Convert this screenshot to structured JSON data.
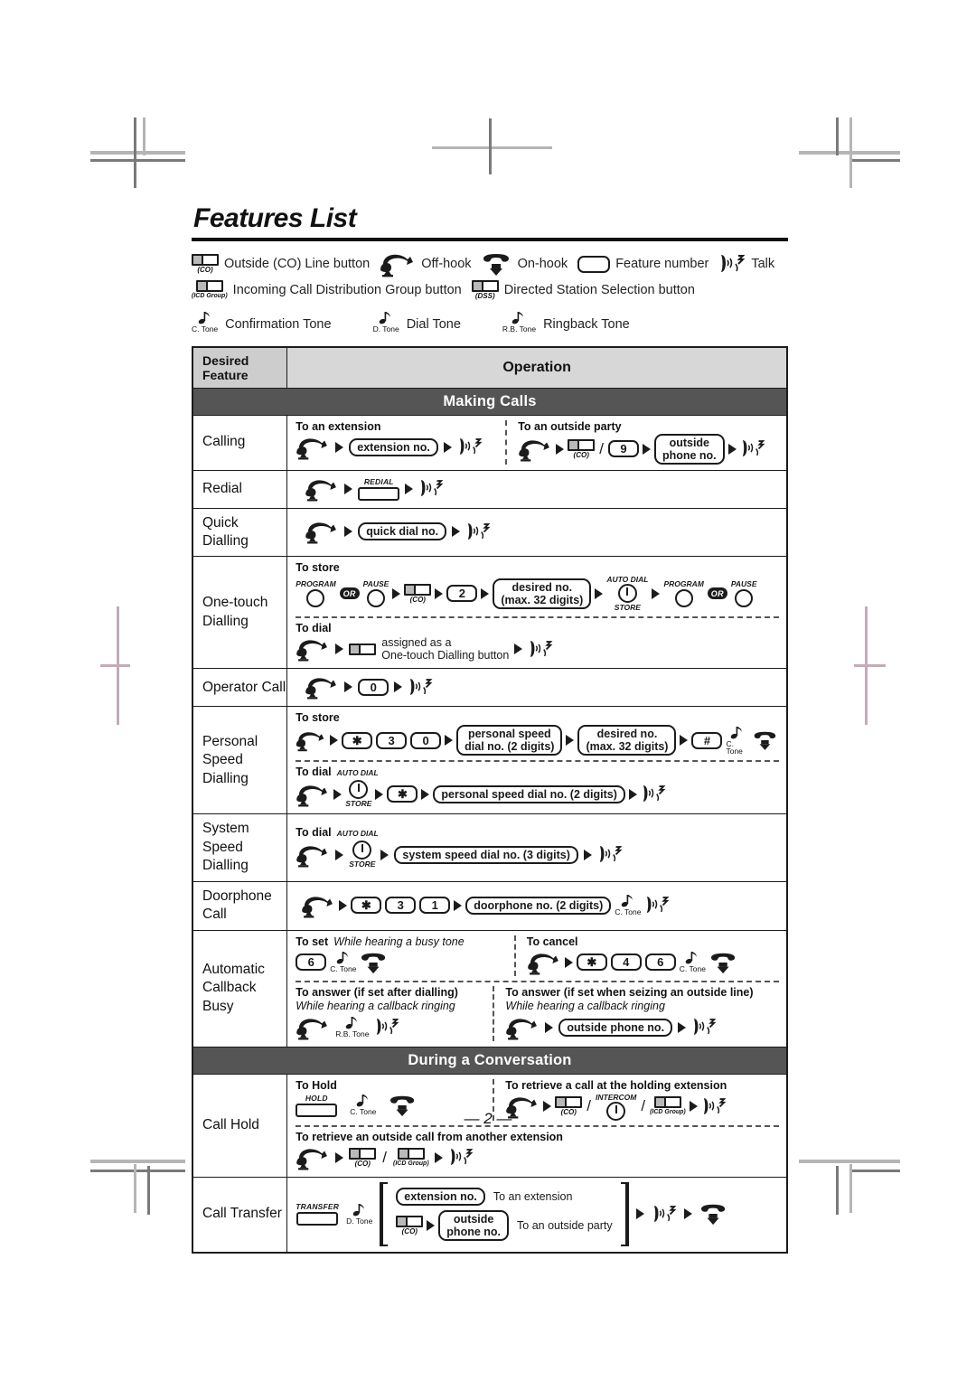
{
  "document": {
    "title": "Features List",
    "page_number": "— 2 —"
  },
  "legend": {
    "row1": [
      {
        "icon": "co-line-button-icon",
        "cap": "(CO)",
        "label": "Outside (CO) Line button"
      },
      {
        "icon": "off-hook-icon",
        "label": "Off-hook"
      },
      {
        "icon": "on-hook-icon",
        "label": "On-hook"
      },
      {
        "icon": "feature-number-key-icon",
        "label": "Feature number"
      },
      {
        "icon": "talk-icon",
        "label": "Talk"
      }
    ],
    "row2": [
      {
        "icon": "icd-group-button-icon",
        "cap": "(ICD Group)",
        "label": "Incoming Call Distribution Group button"
      },
      {
        "icon": "dss-button-icon",
        "cap": "(DSS)",
        "label": "Directed Station Selection button"
      }
    ],
    "tones": [
      {
        "icon": "tone-note-icon",
        "cap": "C. Tone",
        "label": "Confirmation Tone"
      },
      {
        "icon": "tone-note-icon",
        "cap": "D. Tone",
        "label": "Dial Tone"
      },
      {
        "icon": "tone-note-icon",
        "cap": "R.B. Tone",
        "label": "Ringback Tone"
      }
    ]
  },
  "table": {
    "headers": {
      "feature": "Desired Feature",
      "operation": "Operation"
    },
    "sections": [
      {
        "title": "Making Calls"
      },
      {
        "title": "During a Conversation"
      }
    ],
    "rows": {
      "calling": {
        "feature": "Calling",
        "left_label": "To an extension",
        "left_pill": "extension no.",
        "right_label": "To an outside party",
        "right_key": "9",
        "right_co_cap": "(CO)",
        "right_pill_line1": "outside",
        "right_pill_line2": "phone no."
      },
      "redial": {
        "feature": "Redial",
        "key_cap": "REDIAL"
      },
      "quick_dialling": {
        "feature": "Quick Dialling",
        "pill": "quick dial no."
      },
      "one_touch": {
        "feature_line1": "One-touch",
        "feature_line2": "Dialling",
        "store_label": "To store",
        "store_program_cap": "PROGRAM",
        "store_or": "OR",
        "store_pause_cap": "PAUSE",
        "store_co_cap": "(CO)",
        "store_key": "2",
        "store_pill_line1": "desired no.",
        "store_pill_line2": "(max. 32 digits)",
        "store_autodial_cap": "AUTO DIAL",
        "store_store_cap": "STORE",
        "store_program2_cap": "PROGRAM",
        "store_or2": "OR",
        "store_pause2_cap": "PAUSE",
        "dial_label": "To dial",
        "dial_text_line1": "assigned as a",
        "dial_text_line2": "One-touch Dialling button"
      },
      "operator_call": {
        "feature": "Operator Call",
        "key": "0"
      },
      "personal_speed": {
        "feature_line1": "Personal",
        "feature_line2": "Speed Dialling",
        "store_label": "To store",
        "store_keys": [
          "✱",
          "3",
          "0"
        ],
        "store_pill1_line1": "personal speed",
        "store_pill1_line2": "dial no. (2 digits)",
        "store_pill2_line1": "desired no.",
        "store_pill2_line2": "(max. 32 digits)",
        "store_hash": "#",
        "store_tone_cap": "C. Tone",
        "dial_label": "To dial",
        "dial_autodial_cap": "AUTO DIAL",
        "dial_store_cap": "STORE",
        "dial_star": "✱",
        "dial_pill": "personal speed dial no. (2 digits)"
      },
      "system_speed": {
        "feature_line1": "System",
        "feature_line2": "Speed Dialling",
        "dial_label": "To dial",
        "autodial_cap": "AUTO DIAL",
        "store_cap": "STORE",
        "pill": "system speed dial no. (3 digits)"
      },
      "doorphone": {
        "feature": "Doorphone Call",
        "keys": [
          "✱",
          "3",
          "1"
        ],
        "pill": "doorphone no. (2 digits)",
        "tone_cap": "C. Tone"
      },
      "callback": {
        "feature_line1": "Automatic",
        "feature_line2": "Callback Busy",
        "set_label": "To set",
        "set_sub": "While hearing a busy tone",
        "set_key": "6",
        "set_tone_cap": "C. Tone",
        "cancel_label": "To cancel",
        "cancel_keys": [
          "✱",
          "4",
          "6"
        ],
        "cancel_tone_cap": "C. Tone",
        "answer1_label": "To answer (if set after dialling)",
        "answer1_sub": "While hearing a callback ringing",
        "answer1_tone_cap": "R.B. Tone",
        "answer2_label": "To answer (if set when seizing an outside line)",
        "answer2_sub": "While hearing a callback ringing",
        "answer2_pill": "outside phone no."
      },
      "call_hold": {
        "feature": "Call Hold",
        "hold_label": "To Hold",
        "hold_key_cap": "HOLD",
        "hold_tone_cap": "C. Tone",
        "retrieve_label": "To retrieve a call at the holding extension",
        "retrieve_co_cap": "(CO)",
        "retrieve_intercom_cap": "INTERCOM",
        "retrieve_icd_cap": "(ICD Group)",
        "retrieve2_label": "To retrieve an outside call from another extension",
        "retrieve2_co_cap": "(CO)",
        "retrieve2_icd_cap": "(ICD Group)"
      },
      "call_transfer": {
        "feature": "Call Transfer",
        "key_cap": "TRANSFER",
        "tone_cap": "D. Tone",
        "opt1_pill": "extension no.",
        "opt1_text": "To an extension",
        "opt2_co_cap": "(CO)",
        "opt2_pill_line1": "outside",
        "opt2_pill_line2": "phone no.",
        "opt2_text": "To an outside party"
      }
    }
  },
  "colors": {
    "header_feature_bg": "#cdcdcd",
    "header_operation_bg": "#d7d7d7",
    "section_band_bg": "#555555",
    "ink": "#1b1b1b",
    "regmark": "#7a7a7a",
    "regmark_pink": "#c4aabb"
  }
}
